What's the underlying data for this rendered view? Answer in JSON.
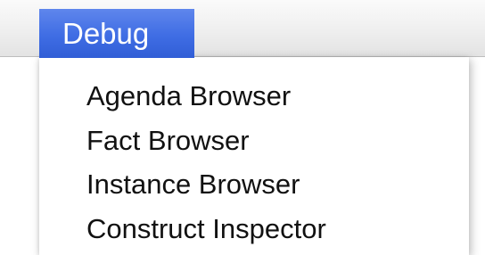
{
  "menu": {
    "title": "Debug",
    "items": [
      {
        "label": "Agenda Browser"
      },
      {
        "label": "Fact Browser"
      },
      {
        "label": "Instance Browser"
      },
      {
        "label": "Construct Inspector"
      }
    ]
  },
  "colors": {
    "menu_highlight": "#3f6de4",
    "menu_text": "#111111",
    "menubar_bg": "#f1f1f1"
  }
}
